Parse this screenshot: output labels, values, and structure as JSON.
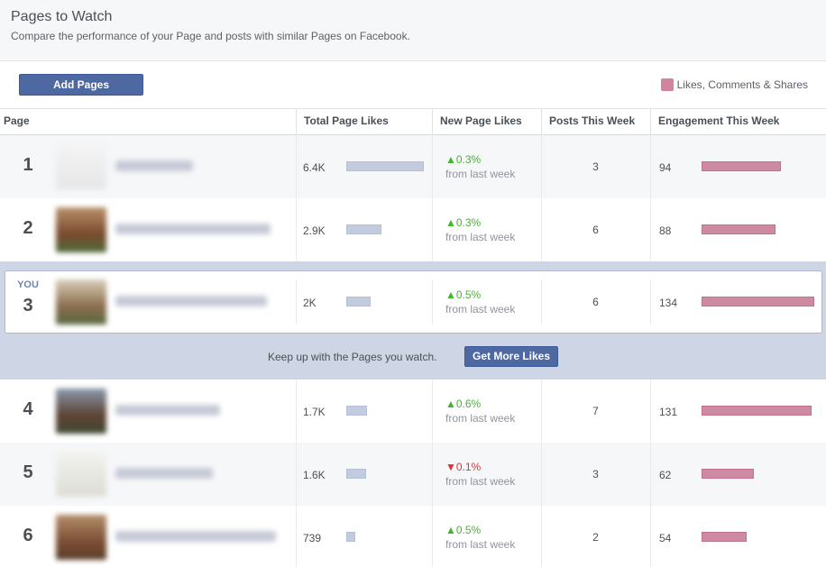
{
  "header": {
    "title": "Pages to Watch",
    "subtitle": "Compare the performance of your Page and posts with similar Pages on Facebook."
  },
  "toolbar": {
    "add_pages_label": "Add Pages",
    "legend_label": "Likes, Comments & Shares",
    "legend_color": "#d0849e"
  },
  "table": {
    "columns": [
      "Page",
      "Total Page Likes",
      "New Page Likes",
      "Posts This Week",
      "Engagement This Week"
    ],
    "delta_sub_label": "from last week",
    "you_label": "YOU",
    "rows": [
      {
        "rank": "1",
        "likes": "6.4K",
        "likes_fraction": 1.0,
        "delta": "0.3%",
        "delta_dir": "up",
        "posts": "3",
        "engagement": "94"
      },
      {
        "rank": "2",
        "likes": "2.9K",
        "likes_fraction": 0.45,
        "delta": "0.3%",
        "delta_dir": "up",
        "posts": "6",
        "engagement": "88"
      },
      {
        "rank": "3",
        "likes": "2K",
        "likes_fraction": 0.31,
        "delta": "0.5%",
        "delta_dir": "up",
        "posts": "6",
        "engagement": "134",
        "is_you": true
      },
      {
        "rank": "4",
        "likes": "1.7K",
        "likes_fraction": 0.27,
        "delta": "0.6%",
        "delta_dir": "up",
        "posts": "7",
        "engagement": "131"
      },
      {
        "rank": "5",
        "likes": "1.6K",
        "likes_fraction": 0.25,
        "delta": "0.1%",
        "delta_dir": "down",
        "posts": "3",
        "engagement": "62"
      },
      {
        "rank": "6",
        "likes": "739",
        "likes_fraction": 0.12,
        "delta": "0.5%",
        "delta_dir": "up",
        "posts": "2",
        "engagement": "54"
      }
    ]
  },
  "promo": {
    "text": "Keep up with the Pages you watch.",
    "button_label": "Get More Likes"
  }
}
